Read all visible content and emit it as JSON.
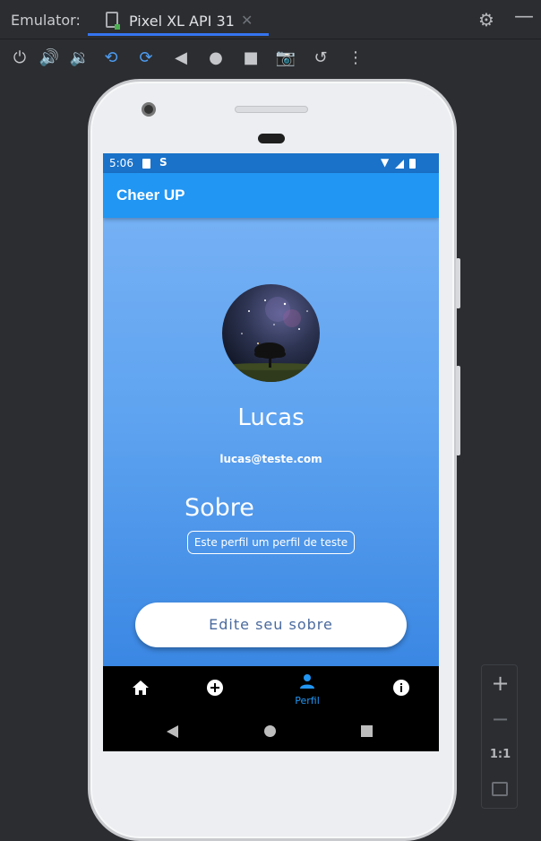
{
  "emulator": {
    "label": "Emulator:",
    "tab_title": "Pixel XL API 31",
    "tab_close": "✕",
    "settings_icon": "gear-icon",
    "minimize_icon": "minimize-icon"
  },
  "toolbar": {
    "buttons": [
      "power-icon",
      "volume-up-icon",
      "volume-down-icon",
      "rotate-left-icon",
      "rotate-right-icon",
      "back-icon",
      "home-icon",
      "overview-icon",
      "screenshot-icon",
      "snapshot-icon",
      "more-icon"
    ]
  },
  "device": {
    "status_bar": {
      "time": "5:06",
      "s_glyph": "S"
    },
    "app": {
      "title": "Cheer UP",
      "profile": {
        "name": "Lucas",
        "email": "lucas@teste.com",
        "about_title": "Sobre",
        "about_text": "Este perfil  um perfil de teste",
        "edit_button": "Edite seu sobre"
      },
      "bottom_nav": {
        "items": [
          {
            "icon": "home-icon",
            "label": ""
          },
          {
            "icon": "add-circle-icon",
            "label": ""
          },
          {
            "icon": "person-icon",
            "label": "Perfil",
            "active": true
          },
          {
            "icon": "info-icon",
            "label": ""
          }
        ]
      }
    },
    "colors": {
      "app_bar": "#2196f3",
      "active_nav": "#2196f3",
      "gradient_top": "#75b0f4",
      "gradient_bottom": "#3a87e3"
    }
  },
  "zoom_controls": {
    "plus": "+",
    "minus": "−",
    "one_to_one": "1:1"
  }
}
